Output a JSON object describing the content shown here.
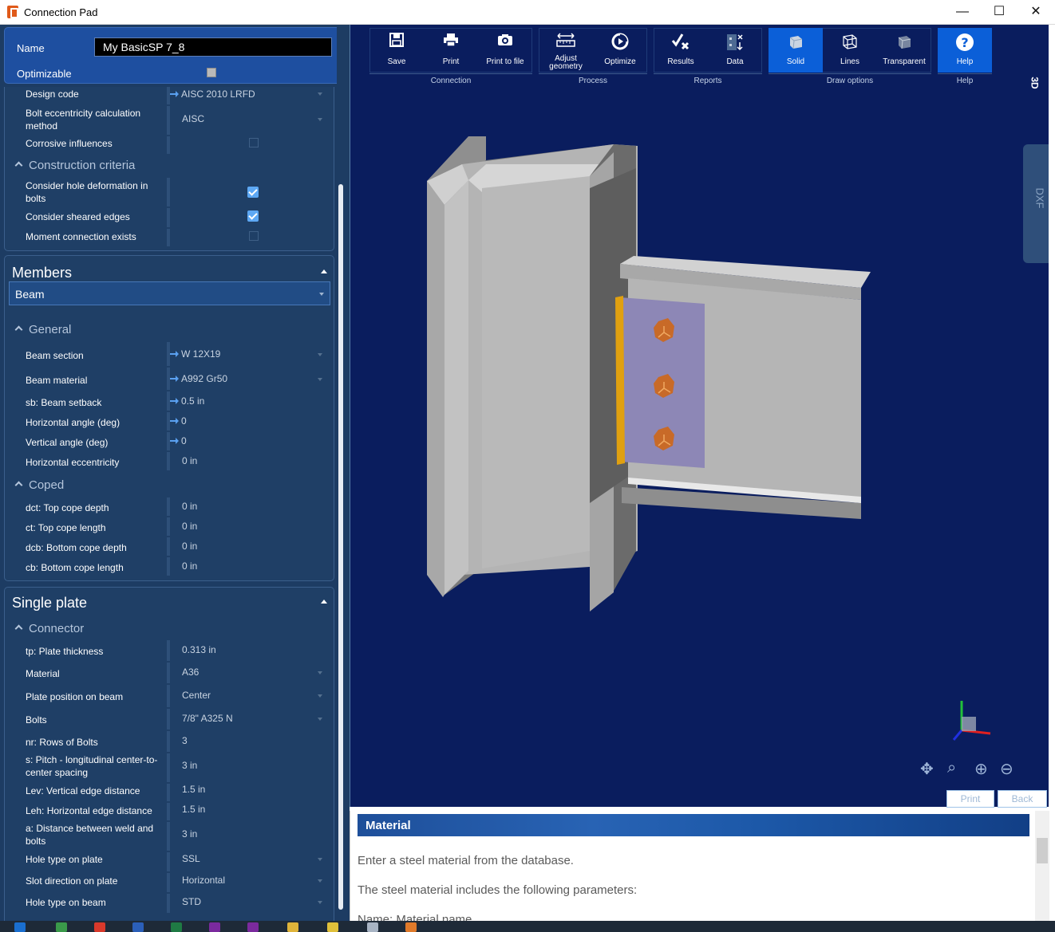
{
  "window": {
    "title": "Connection Pad",
    "minimize": "—",
    "maximize": "☐",
    "close": "✕"
  },
  "header": {
    "name_label": "Name",
    "name_value": "My BasicSP 7_8",
    "optimizable_label": "Optimizable"
  },
  "design": {
    "rows": [
      {
        "label": "Design code",
        "value": "AISC 2010 LRFD"
      },
      {
        "label": "Bolt eccentricity calculation method",
        "value": "AISC"
      },
      {
        "label": "Corrosive influences",
        "value": ""
      }
    ],
    "construction_title": "Construction criteria",
    "construction_rows": [
      {
        "label": "Consider hole deformation in bolts",
        "checked": true
      },
      {
        "label": "Consider sheared edges",
        "checked": true
      },
      {
        "label": "Moment connection exists",
        "checked": false
      }
    ]
  },
  "members": {
    "title": "Members",
    "selected": "Beam",
    "general_title": "General",
    "general_rows": [
      {
        "label": "Beam section",
        "value": "W 12X19"
      },
      {
        "label": "Beam material",
        "value": "A992 Gr50"
      },
      {
        "label": "sb:  Beam setback",
        "value": "0.5 in"
      },
      {
        "label": "Horizontal angle (deg)",
        "value": "0"
      },
      {
        "label": "Vertical angle (deg)",
        "value": "0"
      },
      {
        "label": "Horizontal eccentricity",
        "value": "0 in"
      }
    ],
    "coped_title": "Coped",
    "coped_rows": [
      {
        "label": "dct:  Top cope depth",
        "value": "0 in"
      },
      {
        "label": "ct:  Top cope length",
        "value": "0 in"
      },
      {
        "label": "dcb:  Bottom cope depth",
        "value": "0 in"
      },
      {
        "label": "cb:  Bottom cope length",
        "value": "0 in"
      }
    ]
  },
  "single_plate": {
    "title": "Single plate",
    "connector_title": "Connector",
    "rows": [
      {
        "label": "tp:  Plate thickness",
        "value": "0.313 in"
      },
      {
        "label": "Material",
        "value": "A36"
      },
      {
        "label": "Plate position on beam",
        "value": "Center"
      },
      {
        "label": "Bolts",
        "value": "7/8\" A325 N"
      },
      {
        "label": "nr:  Rows of Bolts",
        "value": "3"
      },
      {
        "label": "s:  Pitch - longitudinal center-to-center spacing",
        "value": "3 in"
      },
      {
        "label": "Lev:  Vertical edge distance",
        "value": "1.5 in"
      },
      {
        "label": "Leh:  Horizontal edge distance",
        "value": "1.5 in"
      },
      {
        "label": "a:  Distance between weld and bolts",
        "value": "3 in"
      },
      {
        "label": "Hole type on plate",
        "value": "SSL"
      },
      {
        "label": "Slot direction on plate",
        "value": "Horizontal"
      },
      {
        "label": "Hole type on beam",
        "value": "STD"
      }
    ]
  },
  "toolbar": {
    "groups": [
      {
        "label": "Connection",
        "buttons": [
          {
            "label": "Save",
            "icon": "save-icon"
          },
          {
            "label": "Print",
            "icon": "print-icon"
          },
          {
            "label": "Print to file",
            "icon": "camera-icon"
          }
        ]
      },
      {
        "label": "Process",
        "buttons": [
          {
            "label": "Adjust geometry",
            "icon": "ruler-icon"
          },
          {
            "label": "Optimize",
            "icon": "optimize-icon"
          }
        ]
      },
      {
        "label": "Reports",
        "buttons": [
          {
            "label": "Results",
            "icon": "results-icon"
          },
          {
            "label": "Data",
            "icon": "data-icon"
          }
        ]
      },
      {
        "label": "Draw options",
        "buttons": [
          {
            "label": "Solid",
            "icon": "solid-cube-icon"
          },
          {
            "label": "Lines",
            "icon": "wireframe-cube-icon"
          },
          {
            "label": "Transparent",
            "icon": "transparent-cube-icon"
          }
        ]
      },
      {
        "label": "Help",
        "buttons": [
          {
            "label": "Help",
            "icon": "help-icon"
          }
        ]
      }
    ]
  },
  "view": {
    "mode_label": "3D",
    "dxf_label": "DXF"
  },
  "bottom_tabs": {
    "print": "Print",
    "back": "Back"
  },
  "help_pane": {
    "title": "Material",
    "p1": "Enter a steel material from the database.",
    "p2": "The steel material includes the following parameters:",
    "p3": "Name: Material name."
  },
  "colors": {
    "panel_bg": "#1d3c63",
    "viewport_bg": "#0a1d5e",
    "accent": "#0b5fd8",
    "checkbox": "#5da8f4"
  }
}
